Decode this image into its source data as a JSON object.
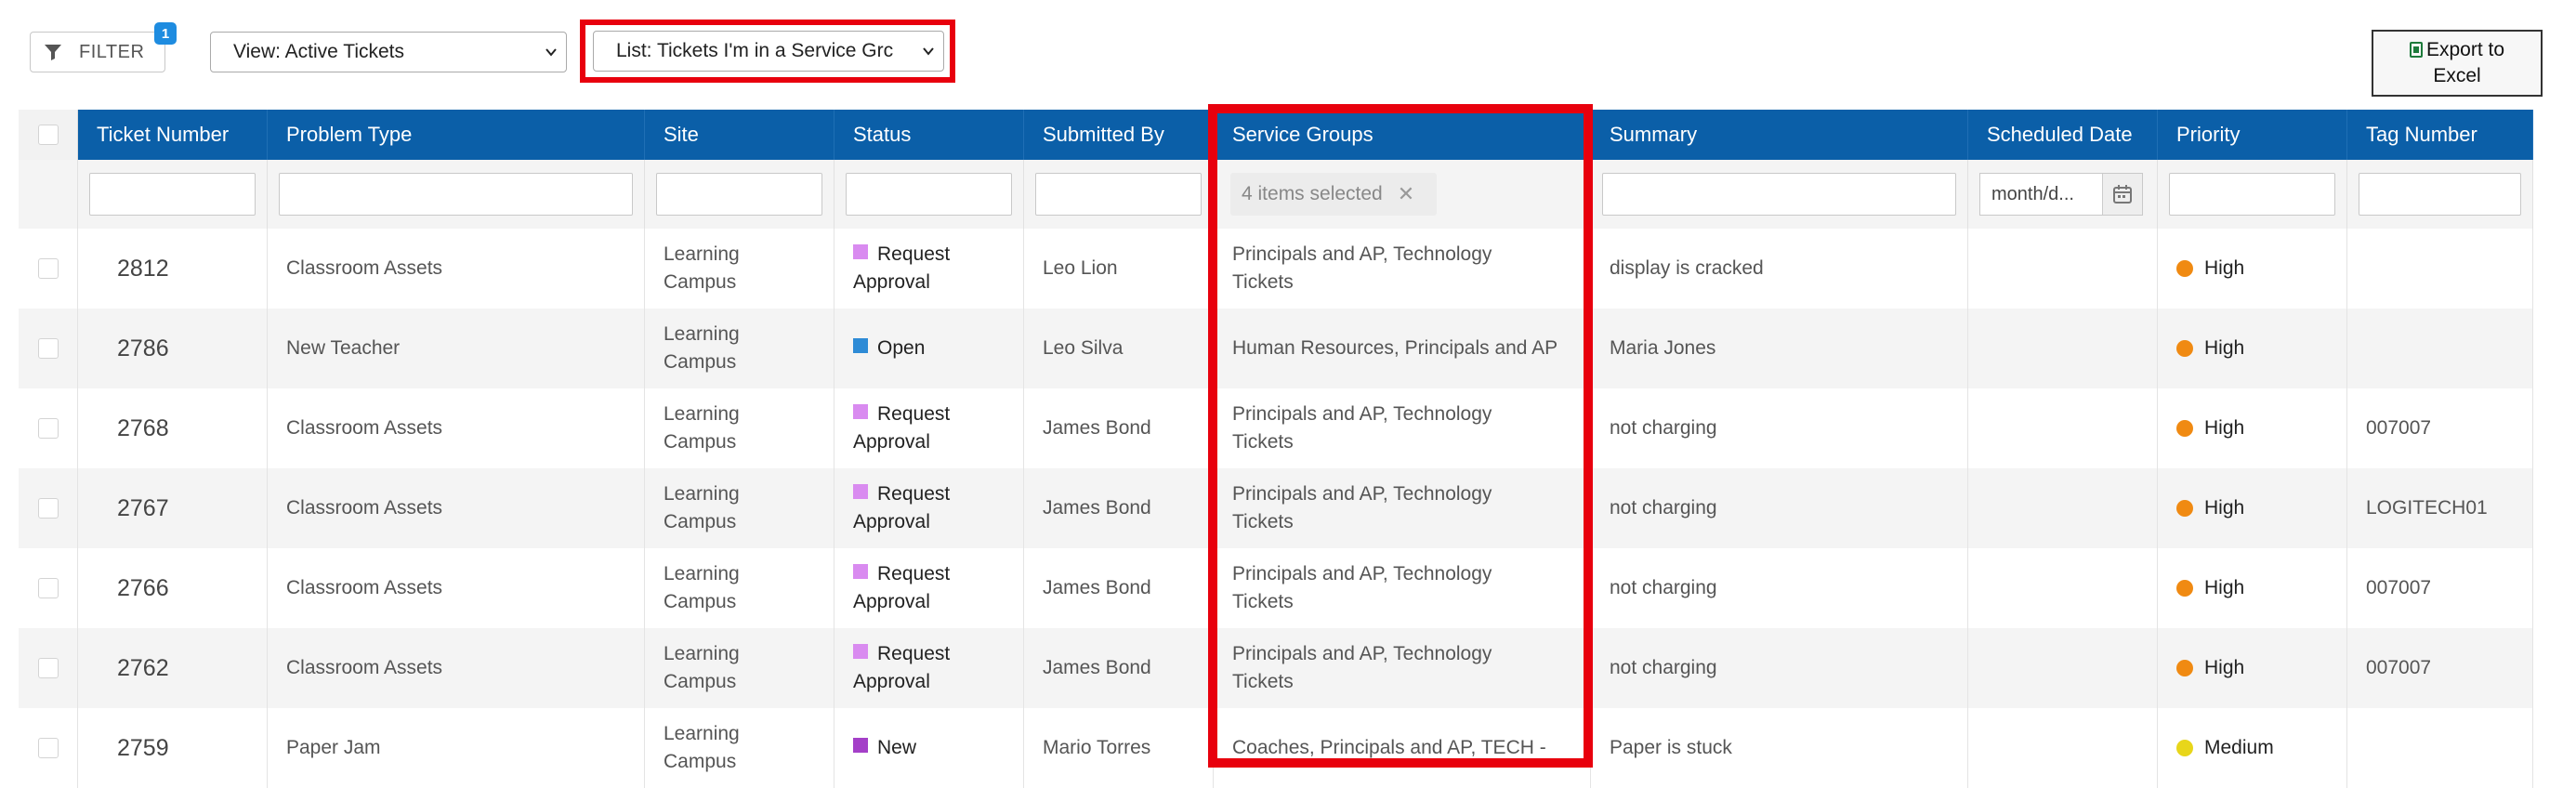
{
  "toolbar": {
    "filter_label": "FILTER",
    "filter_badge": "1",
    "view_select": "View: Active Tickets",
    "list_select": "List: Tickets I'm in a Service Grc",
    "export_label_line1": "Export to",
    "export_label_line2": "Excel"
  },
  "columns": [
    "Ticket Number",
    "Problem Type",
    "Site",
    "Status",
    "Submitted By",
    "Service Groups",
    "Summary",
    "Scheduled Date",
    "Priority",
    "Tag Number"
  ],
  "filters": {
    "service_groups_chip": "4 items selected",
    "date_placeholder": "month/d..."
  },
  "status_colors": {
    "Request Approval": "#d98bf0",
    "Open": "#2e8bd6",
    "New": "#a43fc8"
  },
  "priority_colors": {
    "High": "#f08a12",
    "Medium": "#e8d61a"
  },
  "rows": [
    {
      "ticket": "2812",
      "problem": "Classroom Assets",
      "site1": "Learning",
      "site2": "Campus",
      "status1": "Request",
      "status2": "Approval",
      "submitted": "Leo Lion",
      "groups1": "Principals and AP, Technology",
      "groups2": "Tickets",
      "summary": "display is cracked",
      "scheduled": "",
      "priority": "High",
      "tag": ""
    },
    {
      "ticket": "2786",
      "problem": "New Teacher",
      "site1": "Learning",
      "site2": "Campus",
      "status1": "Open",
      "status2": "",
      "submitted": "Leo Silva",
      "groups1": "Human Resources, Principals and AP",
      "groups2": "",
      "summary": "Maria Jones",
      "scheduled": "",
      "priority": "High",
      "tag": ""
    },
    {
      "ticket": "2768",
      "problem": "Classroom Assets",
      "site1": "Learning",
      "site2": "Campus",
      "status1": "Request",
      "status2": "Approval",
      "submitted": "James Bond",
      "groups1": "Principals and AP, Technology",
      "groups2": "Tickets",
      "summary": "not charging",
      "scheduled": "",
      "priority": "High",
      "tag": "007007"
    },
    {
      "ticket": "2767",
      "problem": "Classroom Assets",
      "site1": "Learning",
      "site2": "Campus",
      "status1": "Request",
      "status2": "Approval",
      "submitted": "James Bond",
      "groups1": "Principals and AP, Technology",
      "groups2": "Tickets",
      "summary": "not charging",
      "scheduled": "",
      "priority": "High",
      "tag": "LOGITECH01"
    },
    {
      "ticket": "2766",
      "problem": "Classroom Assets",
      "site1": "Learning",
      "site2": "Campus",
      "status1": "Request",
      "status2": "Approval",
      "submitted": "James Bond",
      "groups1": "Principals and AP, Technology",
      "groups2": "Tickets",
      "summary": "not charging",
      "scheduled": "",
      "priority": "High",
      "tag": "007007"
    },
    {
      "ticket": "2762",
      "problem": "Classroom Assets",
      "site1": "Learning",
      "site2": "Campus",
      "status1": "Request",
      "status2": "Approval",
      "submitted": "James Bond",
      "groups1": "Principals and AP, Technology",
      "groups2": "Tickets",
      "summary": "not charging",
      "scheduled": "",
      "priority": "High",
      "tag": "007007"
    },
    {
      "ticket": "2759",
      "problem": "Paper Jam",
      "site1": "Learning",
      "site2": "Campus",
      "status1": "New",
      "status2": "",
      "submitted": "Mario Torres",
      "groups1": "Coaches, Principals and AP, TECH -",
      "groups2": "",
      "summary": "Paper is stuck",
      "scheduled": "",
      "priority": "Medium",
      "tag": ""
    }
  ]
}
